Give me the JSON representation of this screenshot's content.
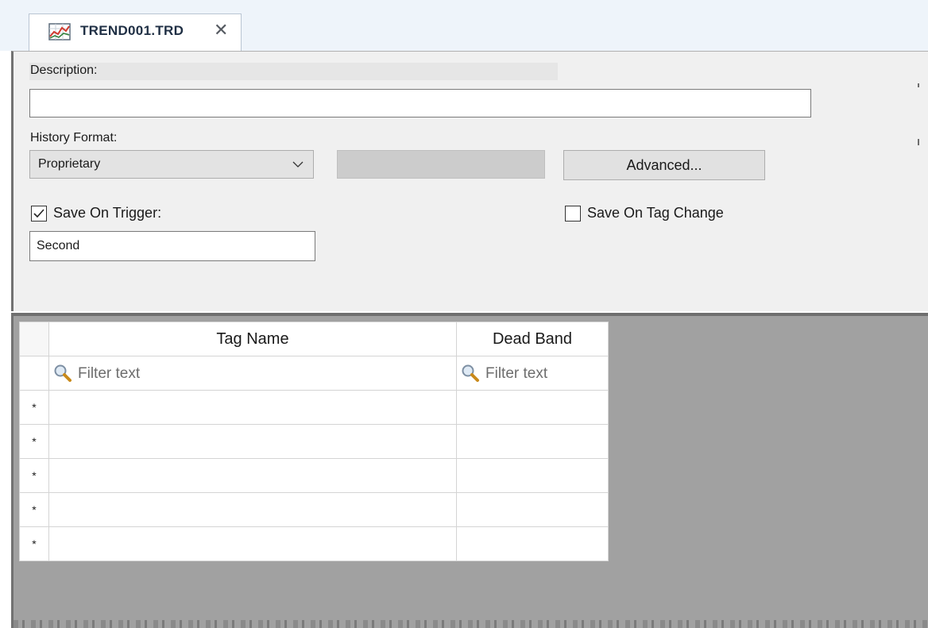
{
  "tab": {
    "title": "TREND001.TRD",
    "icon": "trend-chart-icon",
    "close_symbol": "✕"
  },
  "form": {
    "description_label": "Description:",
    "description_value": "",
    "history_format_label": "History Format:",
    "history_format_value": "Proprietary",
    "history_format_options": [
      "Proprietary"
    ],
    "advanced_button": "Advanced...",
    "save_on_trigger_label": "Save On Trigger:",
    "save_on_trigger_checked": true,
    "save_on_tag_change_label": "Save On Tag Change",
    "save_on_tag_change_checked": false,
    "trigger_value": "Second"
  },
  "grid": {
    "columns": [
      "Tag Name",
      "Dead Band"
    ],
    "filter_placeholder": "Filter text",
    "row_marker": "*",
    "rows": [
      {
        "tag_name": "",
        "dead_band": ""
      },
      {
        "tag_name": "",
        "dead_band": ""
      },
      {
        "tag_name": "",
        "dead_band": ""
      },
      {
        "tag_name": "",
        "dead_band": ""
      },
      {
        "tag_name": "",
        "dead_band": ""
      }
    ]
  },
  "colors": {
    "tab_strip": "#eef4fa",
    "form_background": "#f0f0f0",
    "grid_area_background": "#a1a1a1"
  }
}
